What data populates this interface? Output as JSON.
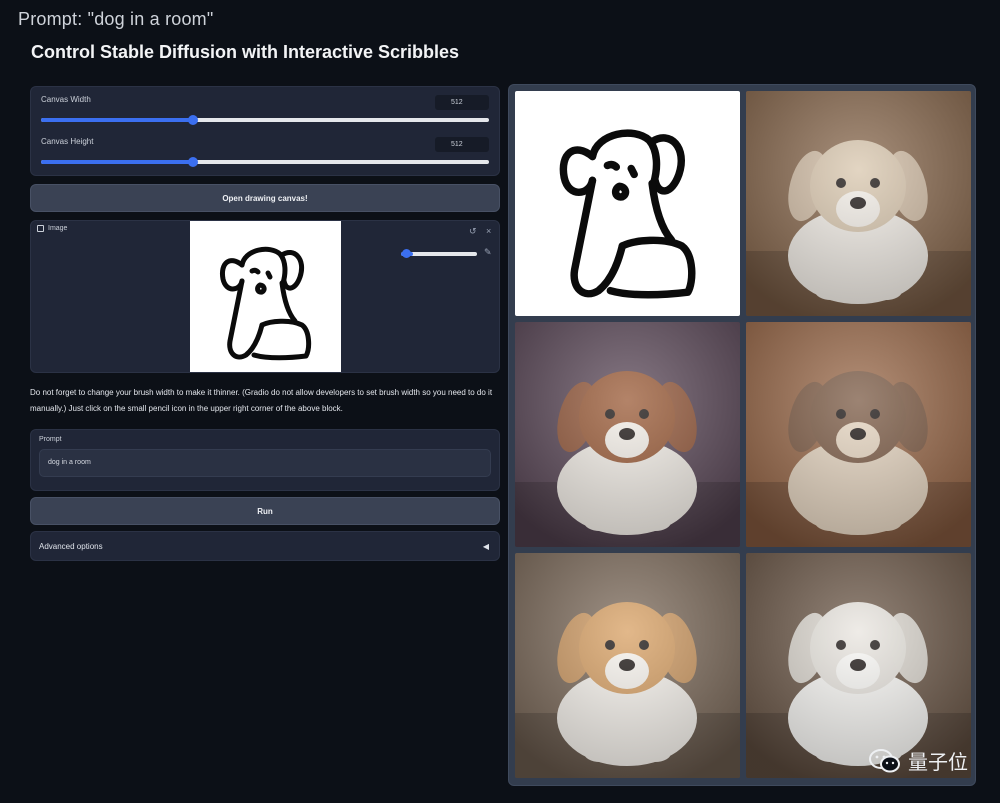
{
  "caption": "Prompt: \"dog in a room\"",
  "app_title": "Control Stable Diffusion with Interactive Scribbles",
  "sliders": [
    {
      "label": "Canvas Width",
      "value": "512",
      "fraction": 0.34
    },
    {
      "label": "Canvas Height",
      "value": "512",
      "fraction": 0.34
    }
  ],
  "open_canvas_button": "Open drawing canvas!",
  "image_block": {
    "label": "Image",
    "brush_width_fraction": 0.1
  },
  "note": "Do not forget to change your brush width to make it thinner. (Gradio do not allow developers to set brush width so you need to do it manually.) Just click on the small pencil icon in the upper right corner of the above block.",
  "prompt": {
    "label": "Prompt",
    "value": "dog in a room"
  },
  "run_button": "Run",
  "advanced_options": {
    "label": "Advanced options",
    "caret": "◀"
  },
  "gallery": {
    "items": [
      {
        "kind": "scribble"
      },
      {
        "kind": "photo",
        "bg": "#8a6a4f",
        "dog": "#d9c7ae",
        "accent": "#f4efe8"
      },
      {
        "kind": "photo",
        "bg": "#5d4a5a",
        "dog": "#9a5a36",
        "accent": "#f6f1ea"
      },
      {
        "kind": "photo",
        "bg": "#9b6a4a",
        "dog": "#7b5a44",
        "accent": "#e8d7c2"
      },
      {
        "kind": "photo",
        "bg": "#7e6c5c",
        "dog": "#d8a063",
        "accent": "#faf6f0"
      },
      {
        "kind": "photo",
        "bg": "#6e5a4a",
        "dog": "#e9e5df",
        "accent": "#fbfaf7"
      }
    ]
  },
  "watermark": "量子位",
  "colors": {
    "accent": "#3b6ff0",
    "panel": "#202637",
    "button": "#3a4254",
    "background": "#0c1017"
  }
}
